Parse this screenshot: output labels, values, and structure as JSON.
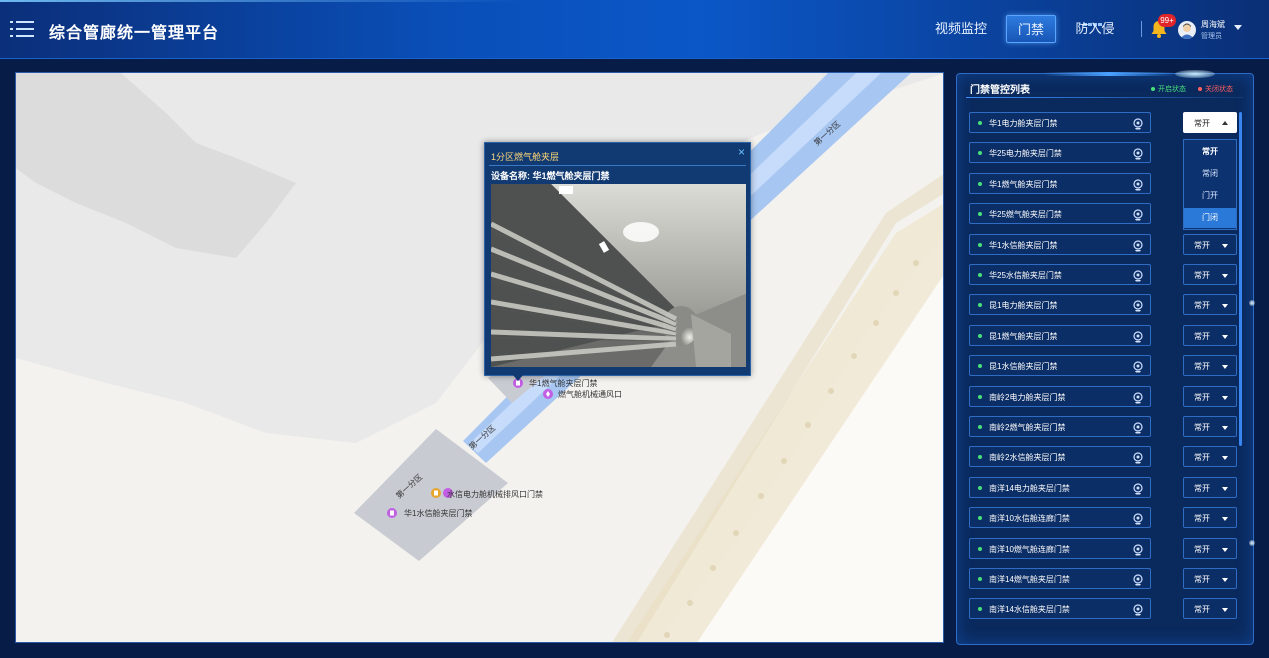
{
  "header": {
    "title": "综合管廊统一管理平台",
    "nav": {
      "video": "视频监控",
      "door": "门禁",
      "intrusion": "防入侵"
    },
    "notifications": "99+",
    "user": {
      "name": "周海斌",
      "role": "管理员"
    }
  },
  "map": {
    "zone_labels": [
      "第一分区",
      "第一分区",
      "第一分区"
    ],
    "markers": [
      {
        "label": "华1燃气舱夹层门禁",
        "icon": "door-marker-icon"
      },
      {
        "label": "燃气舱机械通风口",
        "icon": "fan-marker-icon"
      },
      {
        "label": "水信电力舱机械排风口门禁",
        "icon": "vent-marker-icon"
      },
      {
        "label": "华1水信舱夹层门禁",
        "icon": "door-marker-icon"
      }
    ]
  },
  "popup": {
    "title": "1分区燃气舱夹层",
    "close": "×",
    "device_label": "设备名称: 华1燃气舱夹层门禁"
  },
  "panel": {
    "title": "门禁管控列表",
    "legend": {
      "open": "开启状态",
      "closed": "关闭状态"
    },
    "colors": {
      "open": "#47e07b",
      "closed": "#ff5f5f"
    },
    "rows": [
      {
        "name": "华1电力舱夹层门禁",
        "mode": "常开"
      },
      {
        "name": "华25电力舱夹层门禁",
        "mode": ""
      },
      {
        "name": "华1燃气舱夹层门禁",
        "mode": ""
      },
      {
        "name": "华25燃气舱夹层门禁",
        "mode": ""
      },
      {
        "name": "华1水信舱夹层门禁",
        "mode": "常开"
      },
      {
        "name": "华25水信舱夹层门禁",
        "mode": "常开"
      },
      {
        "name": "昆1电力舱夹层门禁",
        "mode": "常开"
      },
      {
        "name": "昆1燃气舱夹层门禁",
        "mode": "常开"
      },
      {
        "name": "昆1水信舱夹层门禁",
        "mode": "常开"
      },
      {
        "name": "南岭2电力舱夹层门禁",
        "mode": "常开"
      },
      {
        "name": "南岭2燃气舱夹层门禁",
        "mode": "常开"
      },
      {
        "name": "南岭2水信舱夹层门禁",
        "mode": "常开"
      },
      {
        "name": "南洋14电力舱夹层门禁",
        "mode": "常开"
      },
      {
        "name": "南洋10水信舱连廊门禁",
        "mode": "常开"
      },
      {
        "name": "南洋10燃气舱连廊门禁",
        "mode": "常开"
      },
      {
        "name": "南洋14燃气舱夹层门禁",
        "mode": "常开"
      },
      {
        "name": "南洋14水信舱夹层门禁",
        "mode": "常开"
      }
    ],
    "dropdown": {
      "options": [
        "常开",
        "常闭",
        "门开",
        "门闭"
      ],
      "selected": "常开",
      "highlighted": "门闭"
    }
  }
}
